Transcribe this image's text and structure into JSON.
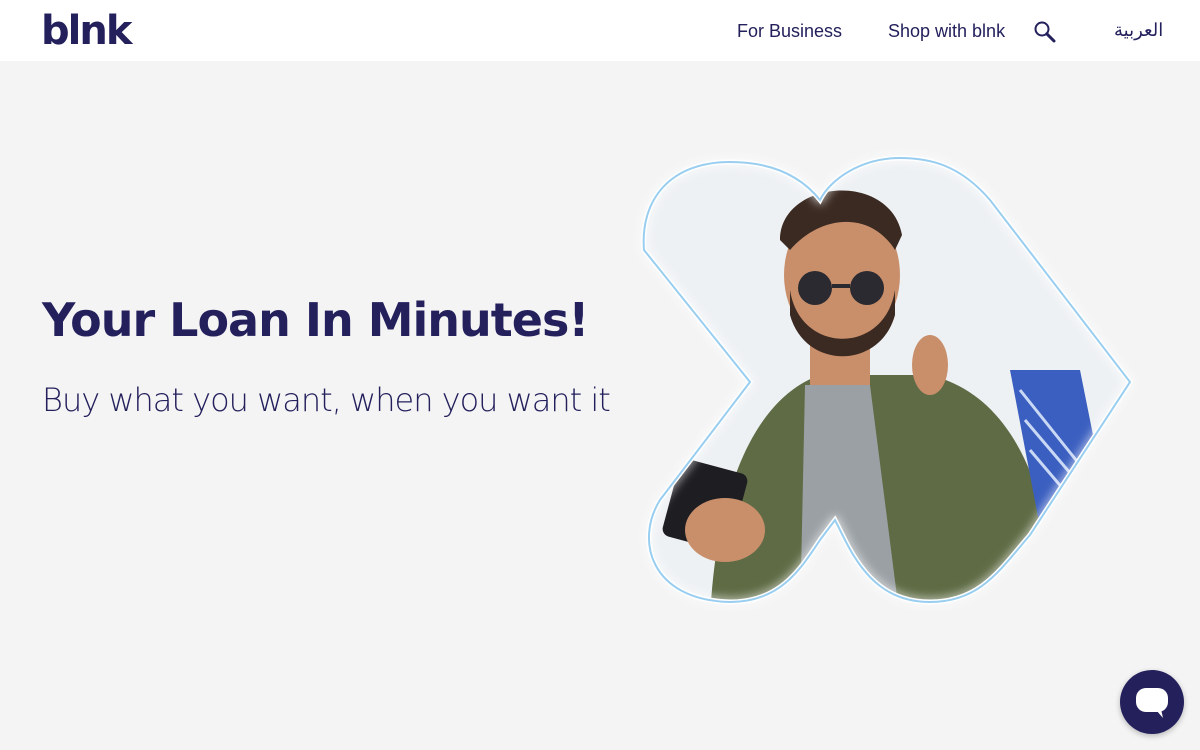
{
  "header": {
    "logo": "blnk",
    "nav": {
      "for_business": "For Business",
      "shop": "Shop with blnk",
      "language": "العربية"
    },
    "search_icon": "search-icon"
  },
  "hero": {
    "title": "Your Loan In Minutes!",
    "subtitle": "Buy what you want, when you want it"
  },
  "chat": {
    "icon": "chat-bubble-icon"
  },
  "colors": {
    "brand": "#23205c",
    "background": "#f4f4f5",
    "header": "#ffffff",
    "glow": "#8fc9ee"
  }
}
